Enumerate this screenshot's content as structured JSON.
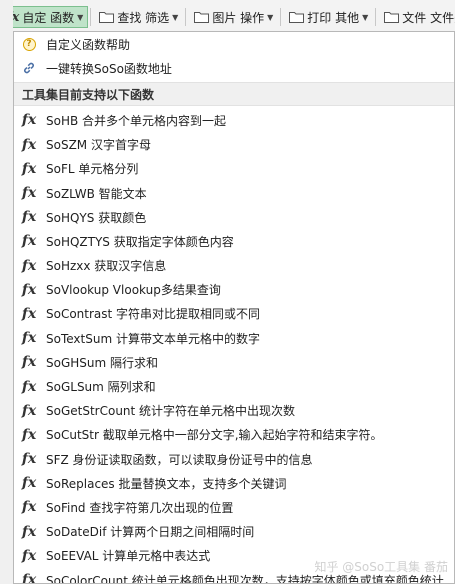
{
  "toolbar": {
    "buttons": [
      {
        "label": "自定 函数",
        "icon": "fx-icon",
        "active": true
      },
      {
        "label": "查找 筛选",
        "icon": "folder-icon",
        "active": false
      },
      {
        "label": "图片 操作",
        "icon": "folder-icon",
        "active": false
      },
      {
        "label": "打印 其他",
        "icon": "folder-icon",
        "active": false
      },
      {
        "label": "文件 文件夹",
        "icon": "folder-icon",
        "active": false
      }
    ]
  },
  "menu": {
    "help": {
      "label": "自定义函数帮助",
      "icon": "help-icon"
    },
    "soso": {
      "label": "一键转换SoSo函数地址",
      "icon": "link-icon"
    },
    "section_title": "工具集目前支持以下函数",
    "functions": [
      "SoHB 合并多个单元格内容到一起",
      "SoSZM 汉字首字母",
      "SoFL 单元格分列",
      "SoZLWB 智能文本",
      "SoHQYS 获取颜色",
      "SoHQZTYS 获取指定字体颜色内容",
      "SoHzxx 获取汉字信息",
      "SoVlookup Vlookup多结果查询",
      "SoContrast 字符串对比提取相同或不同",
      "SoTextSum 计算带文本单元格中的数字",
      "SoGHSum 隔行求和",
      "SoGLSum 隔列求和",
      "SoGetStrCount 统计字符在单元格中出现次数",
      "SoCutStr 截取单元格中一部分文字,输入起始字符和结束字符。",
      "SFZ 身份证读取函数，可以读取身份证号中的信息",
      "SoReplaces 批量替换文本，支持多个关键词",
      "SoFind 查找字符第几次出现的位置",
      "SoDateDif 计算两个日期之间相隔时间",
      "SoEEVAL 计算单元格中表达式",
      "SoColorCount 统计单元格颜色出现次数，支持按字体颜色或填充颜色统计"
    ]
  },
  "watermark": "知乎 @SoSo工具集 番茄"
}
